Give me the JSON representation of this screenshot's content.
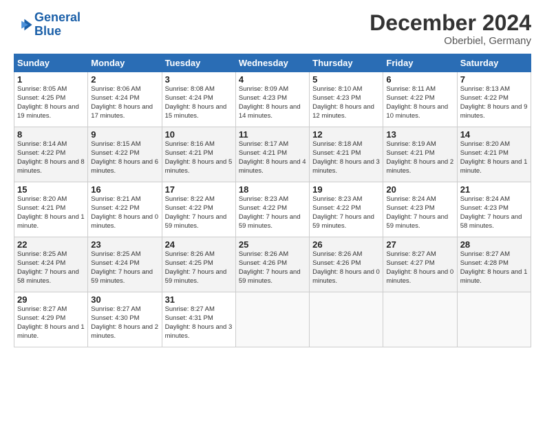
{
  "header": {
    "logo_line1": "General",
    "logo_line2": "Blue",
    "month": "December 2024",
    "location": "Oberbiel, Germany"
  },
  "days_of_week": [
    "Sunday",
    "Monday",
    "Tuesday",
    "Wednesday",
    "Thursday",
    "Friday",
    "Saturday"
  ],
  "weeks": [
    [
      {
        "day": "1",
        "info": "Sunrise: 8:05 AM\nSunset: 4:25 PM\nDaylight: 8 hours and 19 minutes."
      },
      {
        "day": "2",
        "info": "Sunrise: 8:06 AM\nSunset: 4:24 PM\nDaylight: 8 hours and 17 minutes."
      },
      {
        "day": "3",
        "info": "Sunrise: 8:08 AM\nSunset: 4:24 PM\nDaylight: 8 hours and 15 minutes."
      },
      {
        "day": "4",
        "info": "Sunrise: 8:09 AM\nSunset: 4:23 PM\nDaylight: 8 hours and 14 minutes."
      },
      {
        "day": "5",
        "info": "Sunrise: 8:10 AM\nSunset: 4:23 PM\nDaylight: 8 hours and 12 minutes."
      },
      {
        "day": "6",
        "info": "Sunrise: 8:11 AM\nSunset: 4:22 PM\nDaylight: 8 hours and 10 minutes."
      },
      {
        "day": "7",
        "info": "Sunrise: 8:13 AM\nSunset: 4:22 PM\nDaylight: 8 hours and 9 minutes."
      }
    ],
    [
      {
        "day": "8",
        "info": "Sunrise: 8:14 AM\nSunset: 4:22 PM\nDaylight: 8 hours and 8 minutes."
      },
      {
        "day": "9",
        "info": "Sunrise: 8:15 AM\nSunset: 4:22 PM\nDaylight: 8 hours and 6 minutes."
      },
      {
        "day": "10",
        "info": "Sunrise: 8:16 AM\nSunset: 4:21 PM\nDaylight: 8 hours and 5 minutes."
      },
      {
        "day": "11",
        "info": "Sunrise: 8:17 AM\nSunset: 4:21 PM\nDaylight: 8 hours and 4 minutes."
      },
      {
        "day": "12",
        "info": "Sunrise: 8:18 AM\nSunset: 4:21 PM\nDaylight: 8 hours and 3 minutes."
      },
      {
        "day": "13",
        "info": "Sunrise: 8:19 AM\nSunset: 4:21 PM\nDaylight: 8 hours and 2 minutes."
      },
      {
        "day": "14",
        "info": "Sunrise: 8:20 AM\nSunset: 4:21 PM\nDaylight: 8 hours and 1 minute."
      }
    ],
    [
      {
        "day": "15",
        "info": "Sunrise: 8:20 AM\nSunset: 4:21 PM\nDaylight: 8 hours and 1 minute."
      },
      {
        "day": "16",
        "info": "Sunrise: 8:21 AM\nSunset: 4:22 PM\nDaylight: 8 hours and 0 minutes."
      },
      {
        "day": "17",
        "info": "Sunrise: 8:22 AM\nSunset: 4:22 PM\nDaylight: 7 hours and 59 minutes."
      },
      {
        "day": "18",
        "info": "Sunrise: 8:23 AM\nSunset: 4:22 PM\nDaylight: 7 hours and 59 minutes."
      },
      {
        "day": "19",
        "info": "Sunrise: 8:23 AM\nSunset: 4:22 PM\nDaylight: 7 hours and 59 minutes."
      },
      {
        "day": "20",
        "info": "Sunrise: 8:24 AM\nSunset: 4:23 PM\nDaylight: 7 hours and 59 minutes."
      },
      {
        "day": "21",
        "info": "Sunrise: 8:24 AM\nSunset: 4:23 PM\nDaylight: 7 hours and 58 minutes."
      }
    ],
    [
      {
        "day": "22",
        "info": "Sunrise: 8:25 AM\nSunset: 4:24 PM\nDaylight: 7 hours and 58 minutes."
      },
      {
        "day": "23",
        "info": "Sunrise: 8:25 AM\nSunset: 4:24 PM\nDaylight: 7 hours and 59 minutes."
      },
      {
        "day": "24",
        "info": "Sunrise: 8:26 AM\nSunset: 4:25 PM\nDaylight: 7 hours and 59 minutes."
      },
      {
        "day": "25",
        "info": "Sunrise: 8:26 AM\nSunset: 4:26 PM\nDaylight: 7 hours and 59 minutes."
      },
      {
        "day": "26",
        "info": "Sunrise: 8:26 AM\nSunset: 4:26 PM\nDaylight: 8 hours and 0 minutes."
      },
      {
        "day": "27",
        "info": "Sunrise: 8:27 AM\nSunset: 4:27 PM\nDaylight: 8 hours and 0 minutes."
      },
      {
        "day": "28",
        "info": "Sunrise: 8:27 AM\nSunset: 4:28 PM\nDaylight: 8 hours and 1 minute."
      }
    ],
    [
      {
        "day": "29",
        "info": "Sunrise: 8:27 AM\nSunset: 4:29 PM\nDaylight: 8 hours and 1 minute."
      },
      {
        "day": "30",
        "info": "Sunrise: 8:27 AM\nSunset: 4:30 PM\nDaylight: 8 hours and 2 minutes."
      },
      {
        "day": "31",
        "info": "Sunrise: 8:27 AM\nSunset: 4:31 PM\nDaylight: 8 hours and 3 minutes."
      },
      {
        "day": "",
        "info": ""
      },
      {
        "day": "",
        "info": ""
      },
      {
        "day": "",
        "info": ""
      },
      {
        "day": "",
        "info": ""
      }
    ]
  ]
}
